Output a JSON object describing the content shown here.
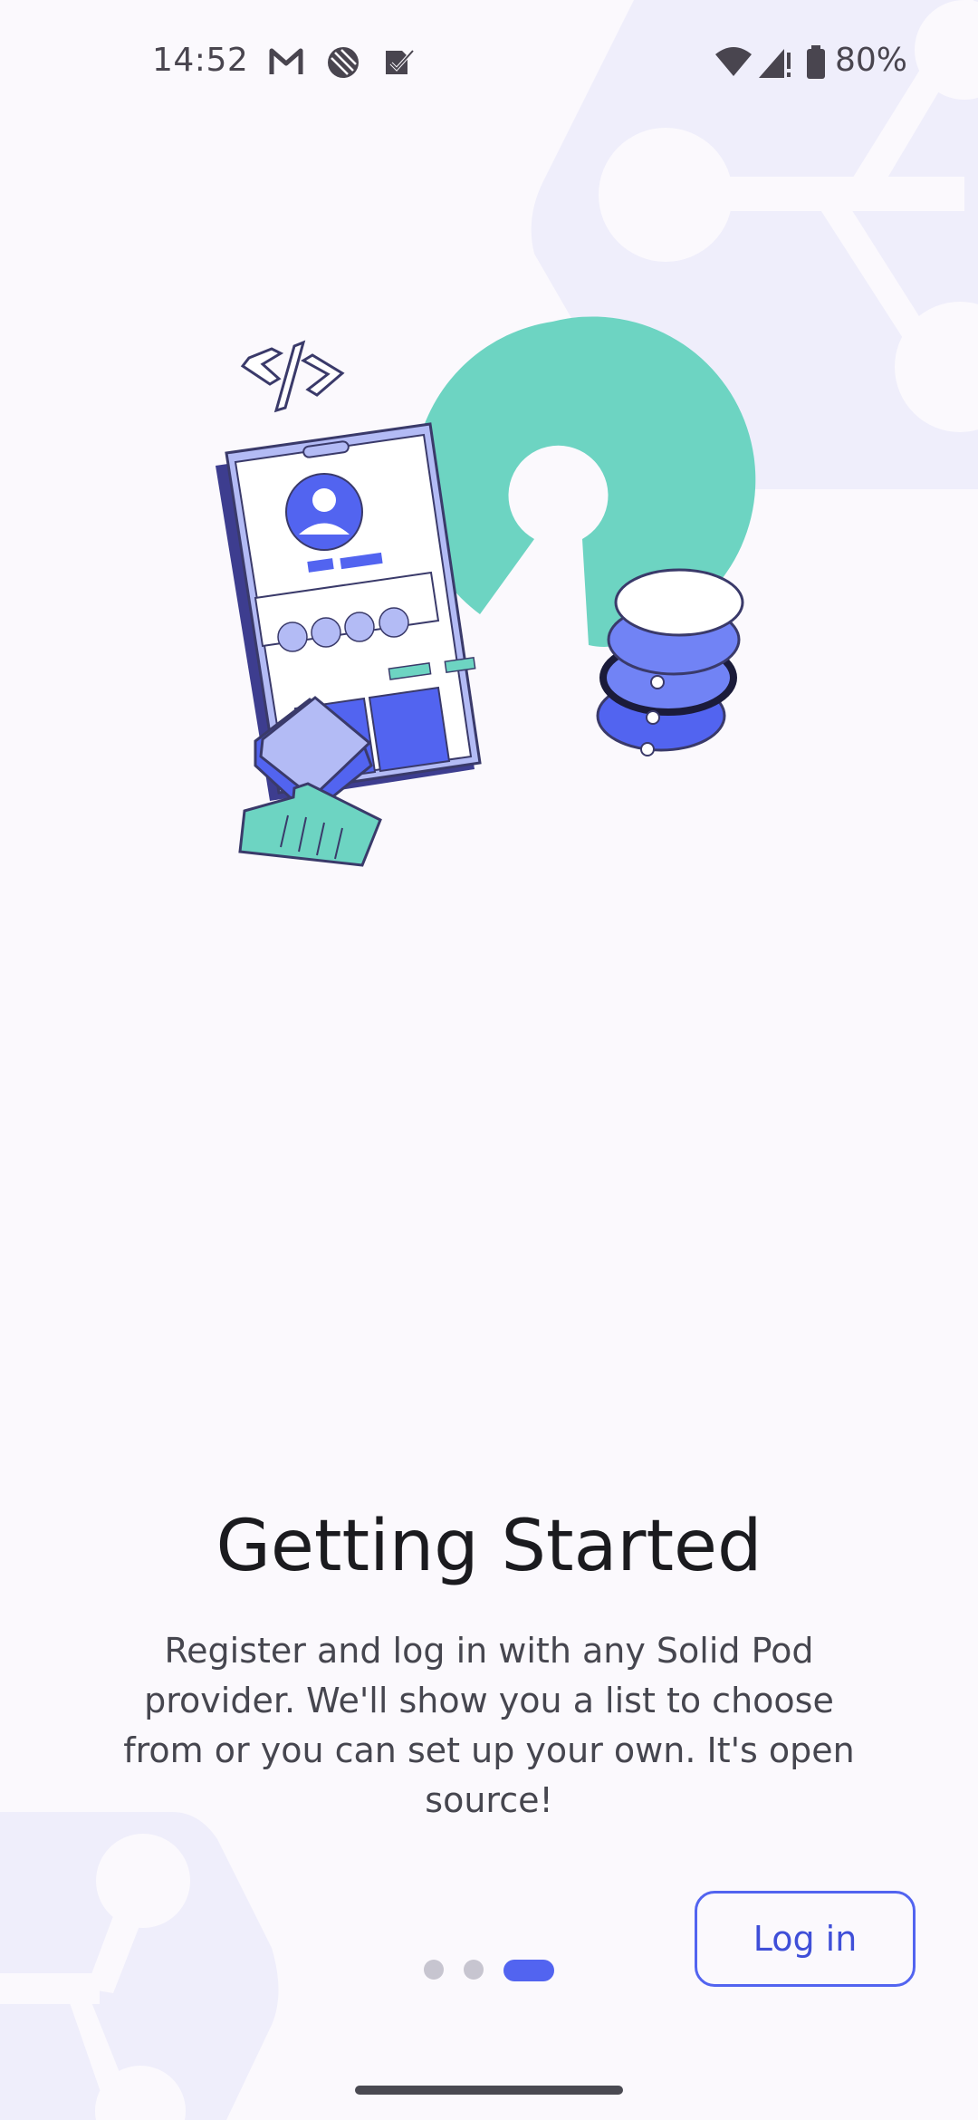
{
  "status_bar": {
    "time": "14:52",
    "notification_icons": [
      "gmail-icon",
      "app-icon",
      "tasks-icon"
    ],
    "system_icons": [
      "wifi-icon",
      "signal-icon",
      "battery-icon"
    ],
    "battery_percent": "80%"
  },
  "onboarding": {
    "illustration": "solid-pod-illustration",
    "title": "Getting Started",
    "description": "Register and log in with any Solid Pod provider. We'll show you a list to choose from or you can set up your own. It's open source!",
    "pager": {
      "total": 3,
      "current": 3
    },
    "login_label": "Log in"
  },
  "colors": {
    "accent": "#5264f0",
    "teal": "#6dd4c2",
    "background": "#fbf9fd",
    "hex_decoration": "#efeefb"
  }
}
